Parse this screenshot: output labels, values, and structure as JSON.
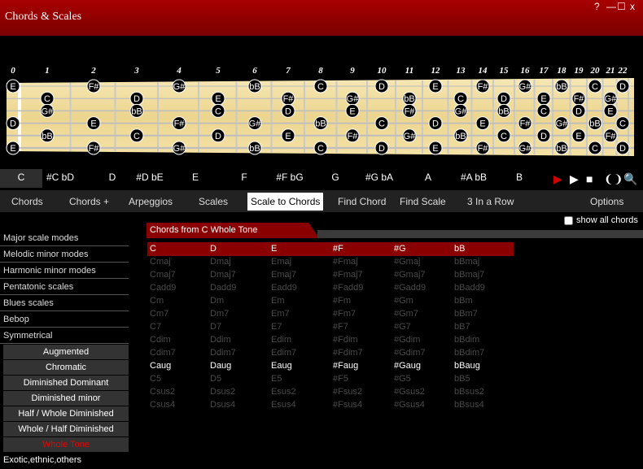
{
  "window": {
    "title": "Chords & Scales",
    "help": "?",
    "minimize": "—",
    "maximize": "☐",
    "close": "x"
  },
  "fretboard": {
    "fret_numbers": [
      "0",
      "1",
      "2",
      "3",
      "4",
      "5",
      "6",
      "7",
      "8",
      "9",
      "10",
      "11",
      "12",
      "13",
      "14",
      "15",
      "16",
      "17",
      "18",
      "19",
      "20",
      "21",
      "22"
    ],
    "strings": [
      [
        "E",
        "",
        "F#",
        "",
        "G#",
        "",
        "bB",
        "",
        "C",
        "",
        "D",
        "",
        "E",
        "",
        "F#",
        "",
        "G#",
        "",
        "bB",
        "",
        "C",
        "",
        "D"
      ],
      [
        "",
        "C",
        "",
        "D",
        "",
        "E",
        "",
        "F#",
        "",
        "G#",
        "",
        "bB",
        "",
        "C",
        "",
        "D",
        "",
        "E",
        "",
        "F#",
        "",
        "G#",
        ""
      ],
      [
        "",
        "G#",
        "",
        "bB",
        "",
        "C",
        "",
        "D",
        "",
        "E",
        "",
        "F#",
        "",
        "G#",
        "",
        "bB",
        "",
        "C",
        "",
        "D",
        "",
        "E",
        ""
      ],
      [
        "D",
        "",
        "E",
        "",
        "F#",
        "",
        "G#",
        "",
        "bB",
        "",
        "C",
        "",
        "D",
        "",
        "E",
        "",
        "F#",
        "",
        "G#",
        "",
        "bB",
        "",
        "C"
      ],
      [
        "",
        "bB",
        "",
        "C",
        "",
        "D",
        "",
        "E",
        "",
        "F#",
        "",
        "G#",
        "",
        "bB",
        "",
        "C",
        "",
        "D",
        "",
        "E",
        "",
        "F#",
        ""
      ],
      [
        "E",
        "",
        "F#",
        "",
        "G#",
        "",
        "bB",
        "",
        "C",
        "",
        "D",
        "",
        "E",
        "",
        "F#",
        "",
        "G#",
        "",
        "bB",
        "",
        "C",
        "",
        "D"
      ]
    ]
  },
  "notes": [
    "C",
    "#C  bD",
    "D",
    "#D  bE",
    "E",
    "F",
    "#F  bG",
    "G",
    "#G  bA",
    "A",
    "#A  bB",
    "B"
  ],
  "selected_note": "C",
  "controls": {
    "record": "▶",
    "play": "▶",
    "stop": "■",
    "loop": "❨❩",
    "zoom": "🔍"
  },
  "tabs": [
    "Chords",
    "Chords +",
    "Arpeggios",
    "Scales",
    "Scale to Chords",
    "Find Chord",
    "Find Scale",
    "3 In a Row",
    "Options"
  ],
  "active_tab": "Scale to Chords",
  "sidebar": {
    "categories": [
      "Major scale modes",
      "Melodic minor modes",
      "Harmonic minor modes",
      "Pentatonic scales",
      "Blues scales",
      "Bebop",
      "Symmetrical"
    ],
    "symmetrical_items": [
      "Augmented",
      "Chromatic",
      "Diminished Dominant",
      "Diminished minor",
      "Half / Whole Diminished",
      "Whole / Half Diminished",
      "Whole Tone"
    ],
    "active_item": "Whole Tone",
    "footer": "Exotic,ethnic,others"
  },
  "panel": {
    "title": "Chords from C Whole Tone",
    "show_all_label": "show all chords",
    "show_all_checked": false,
    "columns": [
      "C",
      "D",
      "E",
      "#F",
      "#G",
      "bB"
    ],
    "suffixes": [
      "maj",
      "maj7",
      "add9",
      "m",
      "m7",
      "7",
      "dim",
      "dim7",
      "aug",
      "5",
      "sus2",
      "sus4"
    ],
    "highlighted_suffixes": [
      "aug"
    ],
    "rows": [
      [
        "Cmaj",
        "Dmaj",
        "Emaj",
        "#Fmaj",
        "#Gmaj",
        "bBmaj"
      ],
      [
        "Cmaj7",
        "Dmaj7",
        "Emaj7",
        "#Fmaj7",
        "#Gmaj7",
        "bBmaj7"
      ],
      [
        "Cadd9",
        "Dadd9",
        "Eadd9",
        "#Fadd9",
        "#Gadd9",
        "bBadd9"
      ],
      [
        "Cm",
        "Dm",
        "Em",
        "#Fm",
        "#Gm",
        "bBm"
      ],
      [
        "Cm7",
        "Dm7",
        "Em7",
        "#Fm7",
        "#Gm7",
        "bBm7"
      ],
      [
        "C7",
        "D7",
        "E7",
        "#F7",
        "#G7",
        "bB7"
      ],
      [
        "Cdim",
        "Ddim",
        "Edim",
        "#Fdim",
        "#Gdim",
        "bBdim"
      ],
      [
        "Cdim7",
        "Ddim7",
        "Edim7",
        "#Fdim7",
        "#Gdim7",
        "bBdim7"
      ],
      [
        "Caug",
        "Daug",
        "Eaug",
        "#Faug",
        "#Gaug",
        "bBaug"
      ],
      [
        "C5",
        "D5",
        "E5",
        "#F5",
        "#G5",
        "bB5"
      ],
      [
        "Csus2",
        "Dsus2",
        "Esus2",
        "#Fsus2",
        "#Gsus2",
        "bBsus2"
      ],
      [
        "Csus4",
        "Dsus4",
        "Esus4",
        "#Fsus4",
        "#Gsus4",
        "bBsus4"
      ]
    ]
  },
  "colors": {
    "title_bg": "#8a0000",
    "accent_red": "#e00000",
    "wood": "#f0dfa0",
    "dot": "#000000"
  }
}
